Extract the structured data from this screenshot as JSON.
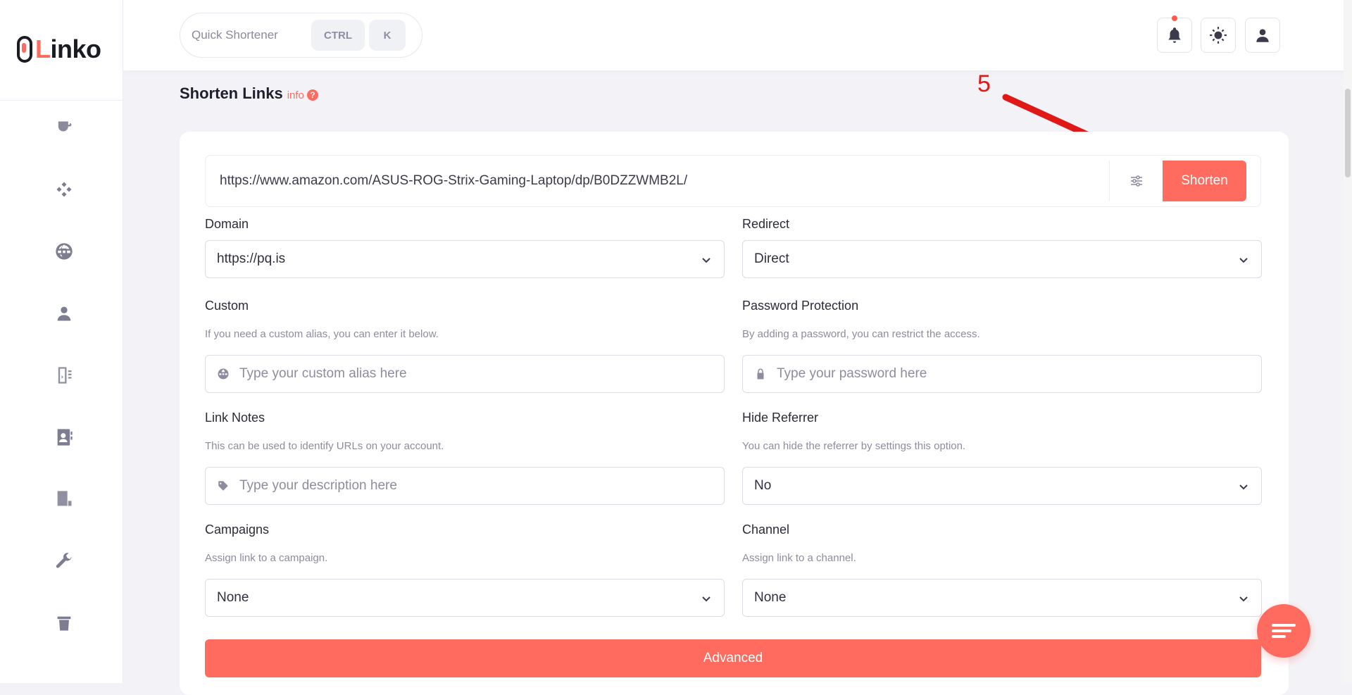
{
  "brand": {
    "name_prefix": "L",
    "name_rest": "inko"
  },
  "topbar": {
    "quick_label": "Quick Shortener",
    "kbd_ctrl": "CTRL",
    "kbd_k": "K"
  },
  "page": {
    "title": "Shorten Links",
    "info_label": "info",
    "info_badge": "?"
  },
  "annotation": {
    "step": "5"
  },
  "url_input": {
    "value": "https://www.amazon.com/ASUS-ROG-Strix-Gaming-Laptop/dp/B0DZZWMB2L/"
  },
  "shorten_label": "Shorten",
  "form": {
    "domain": {
      "label": "Domain",
      "value": "https://pq.is"
    },
    "redirect": {
      "label": "Redirect",
      "value": "Direct"
    },
    "custom": {
      "label": "Custom",
      "help": "If you need a custom alias, you can enter it below.",
      "placeholder": "Type your custom alias here"
    },
    "password": {
      "label": "Password Protection",
      "help": "By adding a password, you can restrict the access.",
      "placeholder": "Type your password here"
    },
    "notes": {
      "label": "Link Notes",
      "help": "This can be used to identify URLs on your account.",
      "placeholder": "Type your description here"
    },
    "referrer": {
      "label": "Hide Referrer",
      "help": "You can hide the referrer by settings this option.",
      "value": "No"
    },
    "campaigns": {
      "label": "Campaigns",
      "help": "Assign link to a campaign.",
      "value": "None"
    },
    "channel": {
      "label": "Channel",
      "help": "Assign link to a channel.",
      "value": "None"
    }
  },
  "advanced_label": "Advanced",
  "colors": {
    "accent": "#ff6b5e",
    "annotation": "#e01818"
  },
  "icons": [
    "cup-icon",
    "apps-icon",
    "globe-icon",
    "user-icon",
    "report-icon",
    "contact-icon",
    "receipt-icon",
    "wrench-icon",
    "trash-icon",
    "bell-icon",
    "sun-icon",
    "user-icon",
    "sliders-icon",
    "globe-icon",
    "lock-icon",
    "tag-icon",
    "menu-icon"
  ]
}
